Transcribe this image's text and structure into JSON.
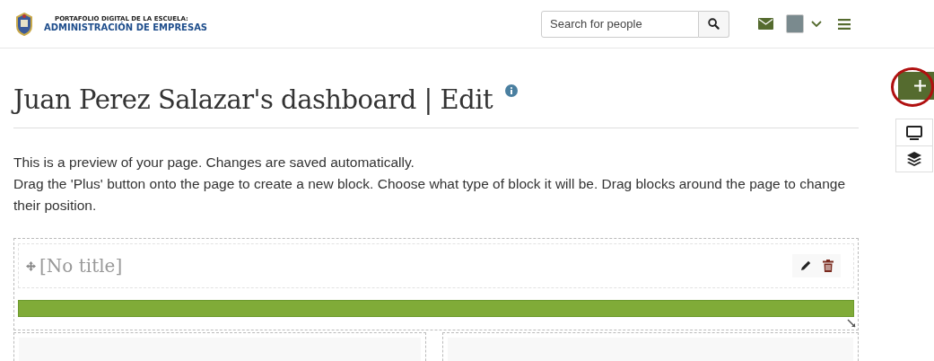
{
  "header": {
    "logo_top": "PORTAFOLIO DIGITAL DE LA ESCUELA:",
    "logo_bottom": "ADMINISTRACIÓN DE EMPRESAS",
    "search": {
      "placeholder": "Search for people"
    }
  },
  "page": {
    "title": "Juan Perez Salazar's dashboard | Edit",
    "intro": [
      "This is a preview of your page. Changes are saved automatically.",
      "Drag the 'Plus' button onto the page to create a new block. Choose what type of block it will be. Drag blocks around the page to change their position."
    ]
  },
  "block": {
    "title": "[No title]"
  }
}
